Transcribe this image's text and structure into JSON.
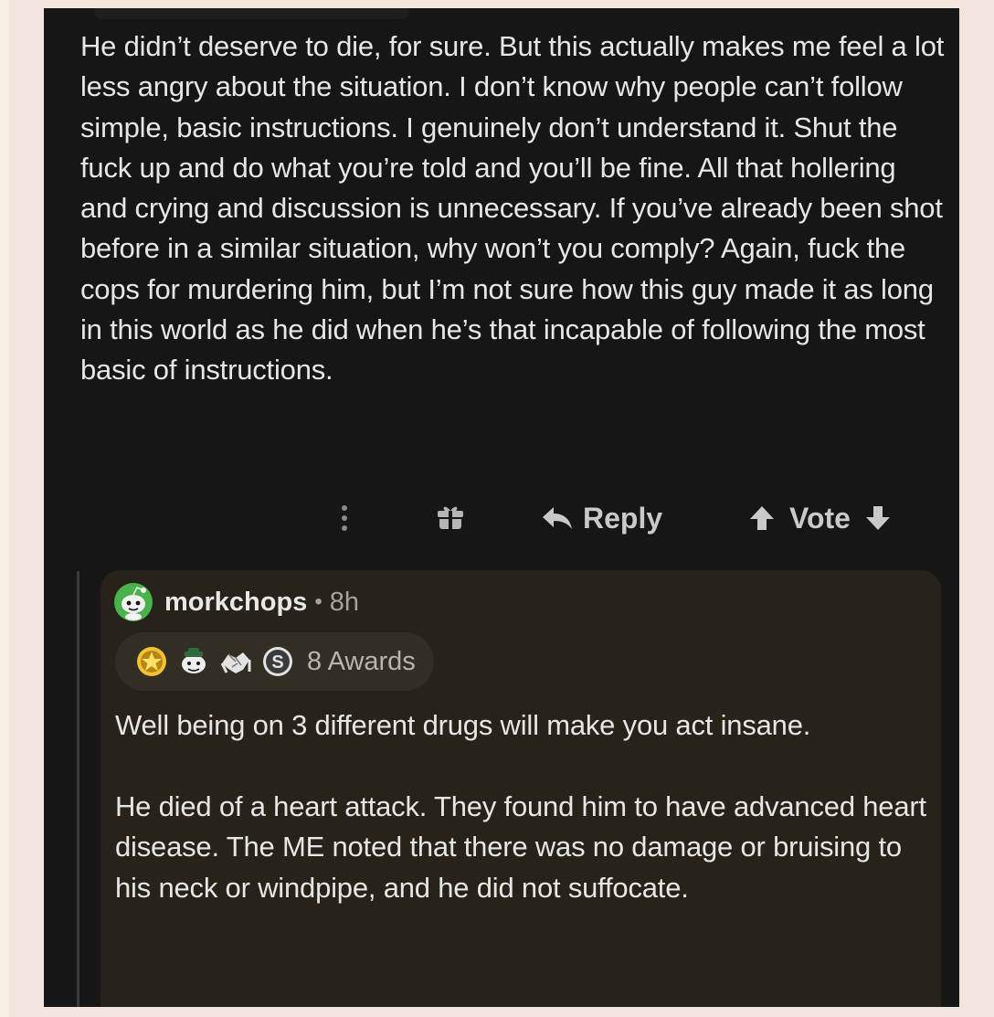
{
  "parent_comment": {
    "body": "He didn’t deserve to die, for sure. But this actually makes me feel a lot less angry about the situation. I don’t know why people can’t follow simple, basic instructions. I genuinely don’t understand it. Shut the fuck up and do what you’re told and you’ll be fine. All that hollering and crying and discussion is unnecessary. If you’ve already been shot before in a similar situation, why won’t you comply? Again, fuck the cops for murdering him, but I’m not sure how this guy made it as long in this world as he did when he’s that incapable of following the most basic of instructions.",
    "actions": {
      "reply_label": "Reply",
      "vote_label": "Vote"
    }
  },
  "reply_comment": {
    "username": "morkchops",
    "separator": "•",
    "age": "8h",
    "awards_count_label": "8 Awards",
    "award_icons": [
      "star-award-icon",
      "wholesome-award-icon",
      "handshake-award-icon",
      "silver-award-icon"
    ],
    "paragraphs": [
      "Well being on 3 different drugs will make you act insane.",
      "He died of a heart attack. They found him to have advanced heart disease. The ME noted that there was no damage or bruising to his neck or windpipe, and he did not suffocate."
    ]
  },
  "colors": {
    "page_background": "#f0e4dc",
    "screen_background": "#161616",
    "reply_card_background": "#28231a",
    "text_primary": "#e6e6e6",
    "text_secondary": "#a6a39c",
    "avatar_green": "#46b44a"
  }
}
